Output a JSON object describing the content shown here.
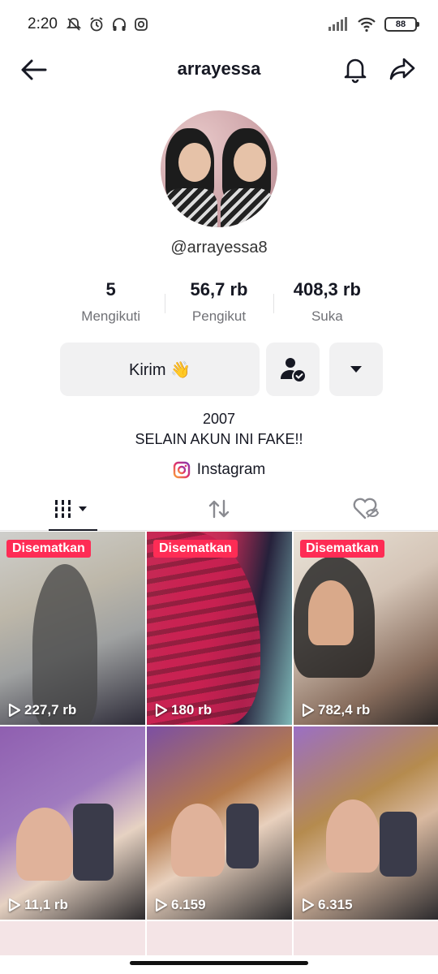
{
  "status_bar": {
    "time": "2:20",
    "battery": "88"
  },
  "header": {
    "title": "arrayessa"
  },
  "profile": {
    "handle": "@arrayessa8",
    "stats": [
      {
        "value": "5",
        "label": "Mengikuti"
      },
      {
        "value": "56,7 rb",
        "label": "Pengikut"
      },
      {
        "value": "408,3 rb",
        "label": "Suka"
      }
    ],
    "send_button": "Kirim 👋",
    "bio_line1": "2007",
    "bio_line2": "SELAIN AKUN INI FAKE!!",
    "link_label": "Instagram"
  },
  "videos": [
    {
      "pinned": "Disematkan",
      "views": "227,7 rb"
    },
    {
      "pinned": "Disematkan",
      "views": "180 rb"
    },
    {
      "pinned": "Disematkan",
      "views": "782,4 rb"
    },
    {
      "views": "11,1 rb"
    },
    {
      "views": "6.159"
    },
    {
      "views": "6.315"
    }
  ],
  "colors": {
    "accent": "#fe2c55",
    "text": "#161823",
    "muted": "#707176",
    "button_bg": "#f1f1f2"
  }
}
